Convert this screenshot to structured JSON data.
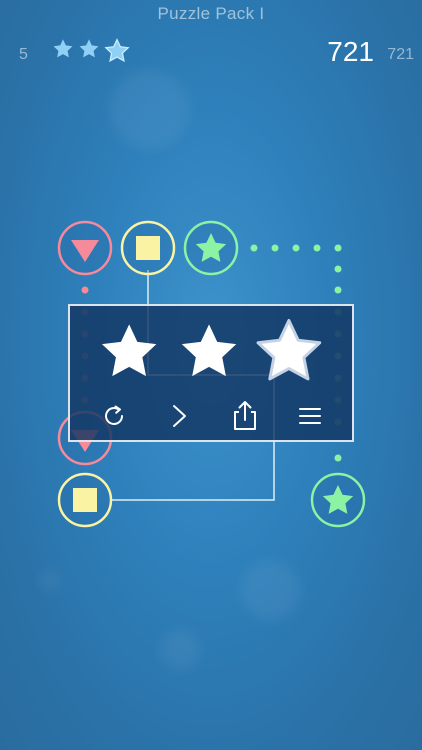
{
  "header": {
    "title": "Puzzle Pack I",
    "level": "5",
    "stars_earned": 3,
    "score": "721",
    "best_score": "721"
  },
  "result_panel": {
    "stars_filled": 3,
    "buttons": [
      {
        "name": "restart",
        "icon": "restart-icon"
      },
      {
        "name": "next",
        "icon": "chevron-right-icon"
      },
      {
        "name": "share",
        "icon": "share-icon"
      },
      {
        "name": "menu",
        "icon": "menu-icon"
      }
    ]
  },
  "pieces": [
    {
      "shape": "triangle",
      "color": "#f48a9a"
    },
    {
      "shape": "square",
      "color": "#fbf3a4"
    },
    {
      "shape": "star",
      "color": "#8cf2a4"
    },
    {
      "shape": "triangle",
      "color": "#f48a9a"
    },
    {
      "shape": "square",
      "color": "#fbf3a4"
    },
    {
      "shape": "star",
      "color": "#8cf2a4"
    }
  ],
  "colors": {
    "pink": "#f48a9a",
    "yellow": "#fbf3a4",
    "green": "#8cf2a4",
    "star_top": "#8fd0f4"
  }
}
